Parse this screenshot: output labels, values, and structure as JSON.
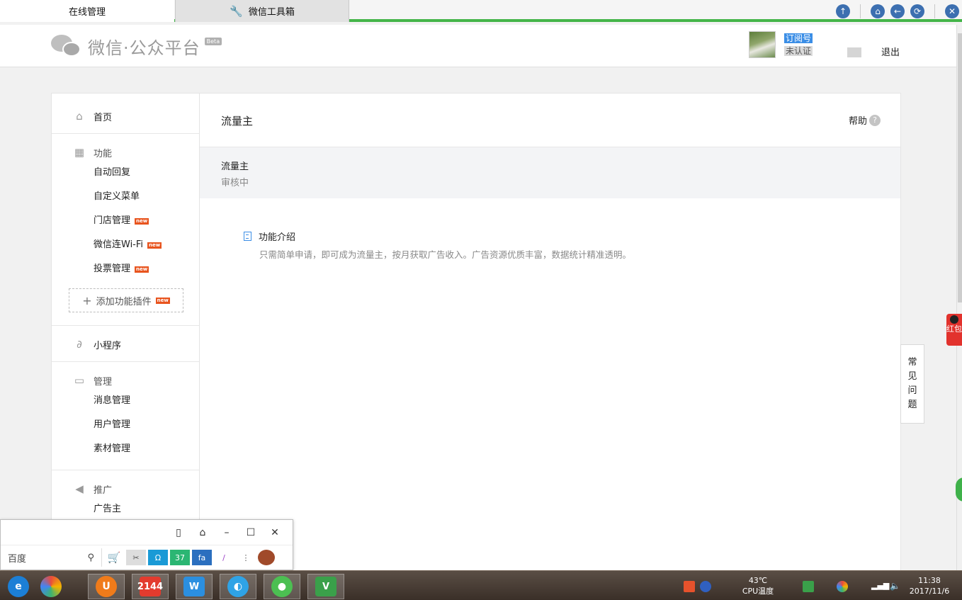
{
  "tabs": [
    {
      "label": "在线管理"
    },
    {
      "label": "微信工具箱"
    }
  ],
  "header": {
    "logo_text": "微信·公众平台",
    "logo_badge": "Beta",
    "account_type": "订阅号",
    "account_auth": "未认证",
    "logout": "退出"
  },
  "sidebar": {
    "home": "首页",
    "features": {
      "title": "功能",
      "items": [
        {
          "label": "自动回复",
          "new": false
        },
        {
          "label": "自定义菜单",
          "new": false
        },
        {
          "label": "门店管理",
          "new": true
        },
        {
          "label": "微信连Wi-Fi",
          "new": true
        },
        {
          "label": "投票管理",
          "new": true
        }
      ],
      "add_plugin": "添加功能插件",
      "new_badge": "new"
    },
    "miniprogram": "小程序",
    "manage": {
      "title": "管理",
      "items": [
        "消息管理",
        "用户管理",
        "素材管理"
      ]
    },
    "promote": {
      "title": "推广",
      "items": [
        "广告主"
      ]
    }
  },
  "content": {
    "title": "流量主",
    "help": "帮助",
    "status_name": "流量主",
    "status_value": "审核中",
    "intro_title": "功能介绍",
    "intro_desc": "只需简单申请，即可成为流量主，按月获取广告收入。广告资源优质丰富，数据统计精准透明。"
  },
  "faq": [
    "常",
    "见",
    "问",
    "题"
  ],
  "redpack": "红包",
  "mini_window": {
    "search_text": "百度"
  },
  "taskbar": {
    "temp_value": "43℃",
    "temp_label": "CPU温度",
    "time": "11:38",
    "date": "2017/11/6"
  },
  "colors": {
    "accent_green": "#44b549",
    "new_badge": "#e8541e",
    "link_blue": "#3b8ee6"
  }
}
